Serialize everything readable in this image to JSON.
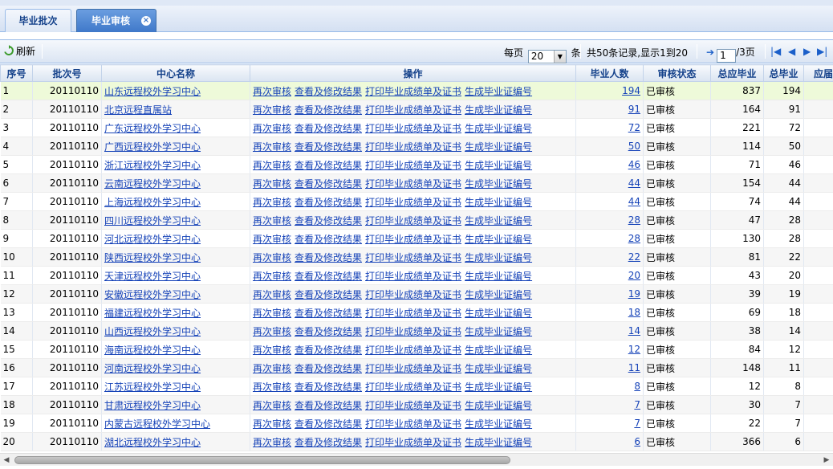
{
  "tabs": [
    {
      "label": "毕业批次",
      "active": false
    },
    {
      "label": "毕业审核",
      "active": true,
      "close": "×"
    }
  ],
  "toolbar": {
    "refresh_label": "刷新",
    "per_page_prefix": "每页",
    "per_page_value": "20",
    "per_page_suffix": "条",
    "record_info": "共50条记录,显示1到20",
    "page_input": "1",
    "page_total": "/3页"
  },
  "columns": [
    "序号",
    "批次号",
    "中心名称",
    "操作",
    "毕业人数",
    "审核状态",
    "总应毕业",
    "总毕业",
    "应届"
  ],
  "actions": [
    "再次审核",
    "查看及修改结果",
    "打印毕业成绩单及证书",
    "生成毕业证编号"
  ],
  "rows": [
    {
      "no": "1",
      "batch": "20110110",
      "center": "山东远程校外学习中心",
      "grads": "194",
      "status": "已审核",
      "total_due": "837",
      "total_grad": "194"
    },
    {
      "no": "2",
      "batch": "20110110",
      "center": "北京远程直属站",
      "grads": "91",
      "status": "已审核",
      "total_due": "164",
      "total_grad": "91"
    },
    {
      "no": "3",
      "batch": "20110110",
      "center": "广东远程校外学习中心",
      "grads": "72",
      "status": "已审核",
      "total_due": "221",
      "total_grad": "72"
    },
    {
      "no": "4",
      "batch": "20110110",
      "center": "广西远程校外学习中心",
      "grads": "50",
      "status": "已审核",
      "total_due": "114",
      "total_grad": "50"
    },
    {
      "no": "5",
      "batch": "20110110",
      "center": "浙江远程校外学习中心",
      "grads": "46",
      "status": "已审核",
      "total_due": "71",
      "total_grad": "46"
    },
    {
      "no": "6",
      "batch": "20110110",
      "center": "云南远程校外学习中心",
      "grads": "44",
      "status": "已审核",
      "total_due": "154",
      "total_grad": "44"
    },
    {
      "no": "7",
      "batch": "20110110",
      "center": "上海远程校外学习中心",
      "grads": "44",
      "status": "已审核",
      "total_due": "74",
      "total_grad": "44"
    },
    {
      "no": "8",
      "batch": "20110110",
      "center": "四川远程校外学习中心",
      "grads": "28",
      "status": "已审核",
      "total_due": "47",
      "total_grad": "28"
    },
    {
      "no": "9",
      "batch": "20110110",
      "center": "河北远程校外学习中心",
      "grads": "28",
      "status": "已审核",
      "total_due": "130",
      "total_grad": "28"
    },
    {
      "no": "10",
      "batch": "20110110",
      "center": "陕西远程校外学习中心",
      "grads": "22",
      "status": "已审核",
      "total_due": "81",
      "total_grad": "22"
    },
    {
      "no": "11",
      "batch": "20110110",
      "center": "天津远程校外学习中心",
      "grads": "20",
      "status": "已审核",
      "total_due": "43",
      "total_grad": "20"
    },
    {
      "no": "12",
      "batch": "20110110",
      "center": "安徽远程校外学习中心",
      "grads": "19",
      "status": "已审核",
      "total_due": "39",
      "total_grad": "19"
    },
    {
      "no": "13",
      "batch": "20110110",
      "center": "福建远程校外学习中心",
      "grads": "18",
      "status": "已审核",
      "total_due": "69",
      "total_grad": "18"
    },
    {
      "no": "14",
      "batch": "20110110",
      "center": "山西远程校外学习中心",
      "grads": "14",
      "status": "已审核",
      "total_due": "38",
      "total_grad": "14"
    },
    {
      "no": "15",
      "batch": "20110110",
      "center": "海南远程校外学习中心",
      "grads": "12",
      "status": "已审核",
      "total_due": "84",
      "total_grad": "12"
    },
    {
      "no": "16",
      "batch": "20110110",
      "center": "河南远程校外学习中心",
      "grads": "11",
      "status": "已审核",
      "total_due": "148",
      "total_grad": "11"
    },
    {
      "no": "17",
      "batch": "20110110",
      "center": "江苏远程校外学习中心",
      "grads": "8",
      "status": "已审核",
      "total_due": "12",
      "total_grad": "8"
    },
    {
      "no": "18",
      "batch": "20110110",
      "center": "甘肃远程校外学习中心",
      "grads": "7",
      "status": "已审核",
      "total_due": "30",
      "total_grad": "7"
    },
    {
      "no": "19",
      "batch": "20110110",
      "center": "内蒙古远程校外学习中心",
      "grads": "7",
      "status": "已审核",
      "total_due": "22",
      "total_grad": "7"
    },
    {
      "no": "20",
      "batch": "20110110",
      "center": "湖北远程校外学习中心",
      "grads": "6",
      "status": "已审核",
      "total_due": "366",
      "total_grad": "6"
    }
  ]
}
